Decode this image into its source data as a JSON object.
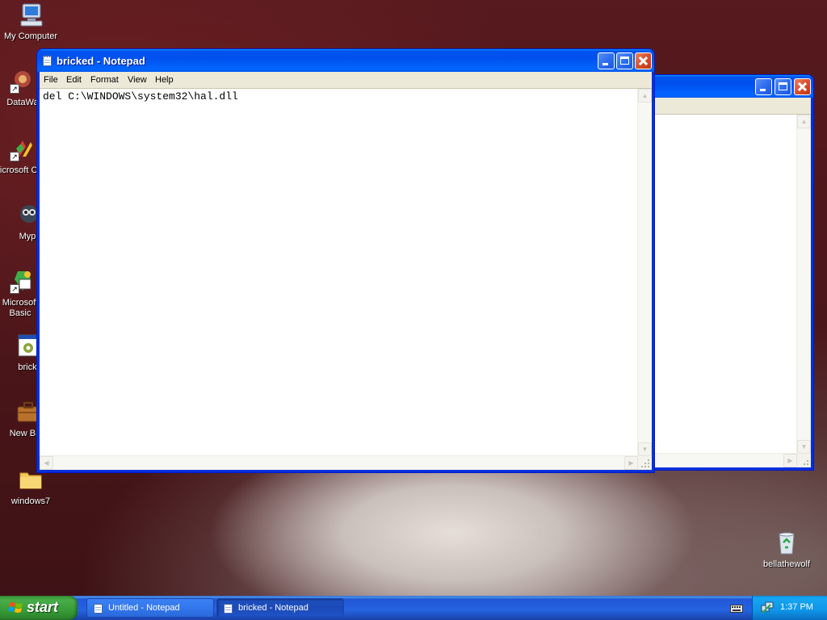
{
  "desktop": {
    "icons": [
      {
        "label": "My Computer"
      },
      {
        "label": "DataWa"
      },
      {
        "label": "Microsoft C++"
      },
      {
        "label": "Myp"
      },
      {
        "label": "Microsoft Basic"
      },
      {
        "label": "brick"
      },
      {
        "label": "New Brie"
      },
      {
        "label": "windows7"
      },
      {
        "label": "bellathewolf"
      }
    ]
  },
  "windows": {
    "back": {
      "title": ""
    },
    "front": {
      "title": "bricked - Notepad",
      "menu": [
        "File",
        "Edit",
        "Format",
        "View",
        "Help"
      ],
      "content": "del C:\\WINDOWS\\system32\\hal.dll"
    }
  },
  "taskbar": {
    "start_label": "start",
    "buttons": [
      {
        "label": "Untitled - Notepad",
        "active": false
      },
      {
        "label": "bricked - Notepad",
        "active": true
      }
    ],
    "clock": "1:37 PM"
  },
  "colors": {
    "title_bar": "#0058ee",
    "start_green": "#3c9a3c",
    "tray_blue": "#0f95e8"
  }
}
